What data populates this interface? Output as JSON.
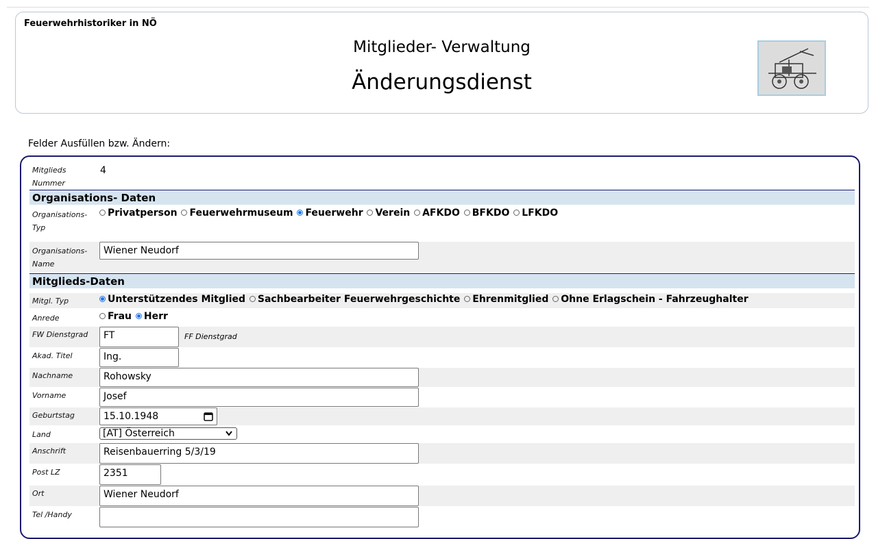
{
  "header": {
    "brand": "Feuerwehrhistoriker in NÖ",
    "title": "Mitglieder- Verwaltung",
    "subtitle": "Änderungsdienst"
  },
  "intro": "Felder Ausfüllen bzw. Ändern:",
  "member": {
    "label": "Mitglieds Nummer",
    "value": "4"
  },
  "org_section": "Organisations- Daten",
  "org_type": {
    "label": "Organisations- Typ",
    "options": [
      "Privatperson",
      "Feuerwehrmuseum",
      "Feuerwehr",
      "Verein",
      "AFKDO",
      "BFKDO",
      "LFKDO"
    ],
    "selected": "Feuerwehr"
  },
  "org_name": {
    "label": "Organisations- Name",
    "value": "Wiener Neudorf"
  },
  "member_section": "Mitglieds-Daten",
  "member_type": {
    "label": "Mitgl. Typ",
    "options": [
      "Unterstützendes Mitglied",
      "Sachbearbeiter Feuerwehrgeschichte",
      "Ehrenmitglied",
      "Ohne Erlagschein - Fahrzeughalter"
    ],
    "selected": "Unterstützendes Mitglied"
  },
  "salutation": {
    "label": "Anrede",
    "options": [
      "Frau",
      "Herr"
    ],
    "selected": "Herr"
  },
  "fw_rank": {
    "label": "FW Dienstgrad",
    "value": "FT",
    "ff_label": "FF Dienstgrad"
  },
  "acad_title": {
    "label": "Akad. Titel",
    "value": "Ing."
  },
  "last_name": {
    "label": "Nachname",
    "value": "Rohowsky"
  },
  "first_name": {
    "label": "Vorname",
    "value": "Josef"
  },
  "birthday": {
    "label": "Geburtstag",
    "value": "15.10.1948"
  },
  "country": {
    "label": "Land",
    "value": "[AT] Österreich"
  },
  "address": {
    "label": "Anschrift",
    "value": "Reisenbauerring 5/3/19"
  },
  "zip": {
    "label": "Post LZ",
    "value": "2351"
  },
  "city": {
    "label": "Ort",
    "value": "Wiener Neudorf"
  },
  "phone": {
    "label": "Tel /Handy",
    "value": ""
  }
}
